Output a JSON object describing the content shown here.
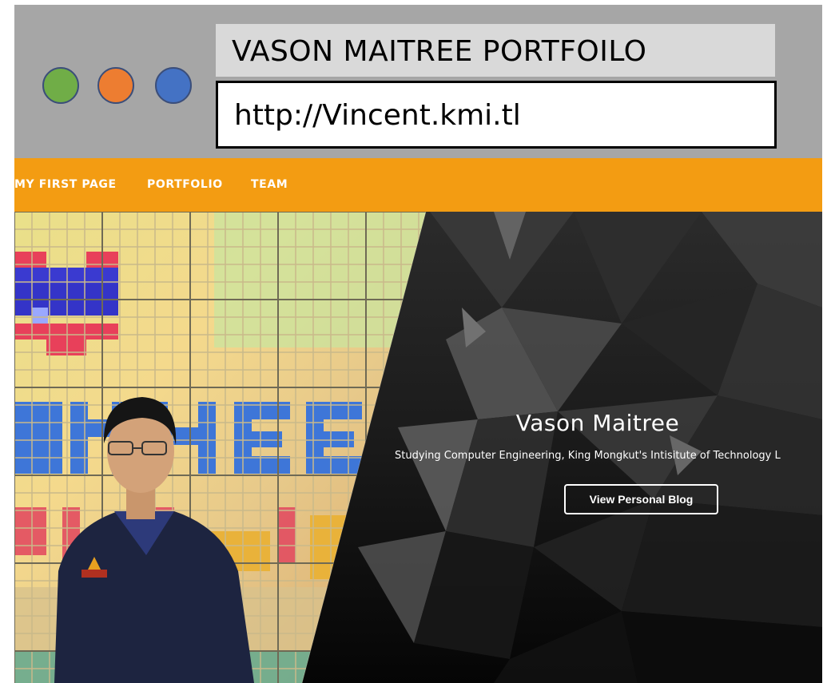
{
  "window": {
    "title": "VASON MAITREE PORTFOILO",
    "url": "http://Vincent.kmi.tl",
    "controls": [
      {
        "name": "green",
        "color": "#70ad47"
      },
      {
        "name": "orange",
        "color": "#ed7d31"
      },
      {
        "name": "blue",
        "color": "#4472c4"
      }
    ]
  },
  "navbar": {
    "color": "#f39c12",
    "items": [
      "MY FIRST PAGE",
      "PORTFOLIO",
      "TEAM"
    ]
  },
  "hero": {
    "name": "Vason Maitree",
    "subtitle": "Studying Computer Engineering, King Mongkut's Intisitute of Technology L",
    "button_label": "View Personal Blog"
  }
}
